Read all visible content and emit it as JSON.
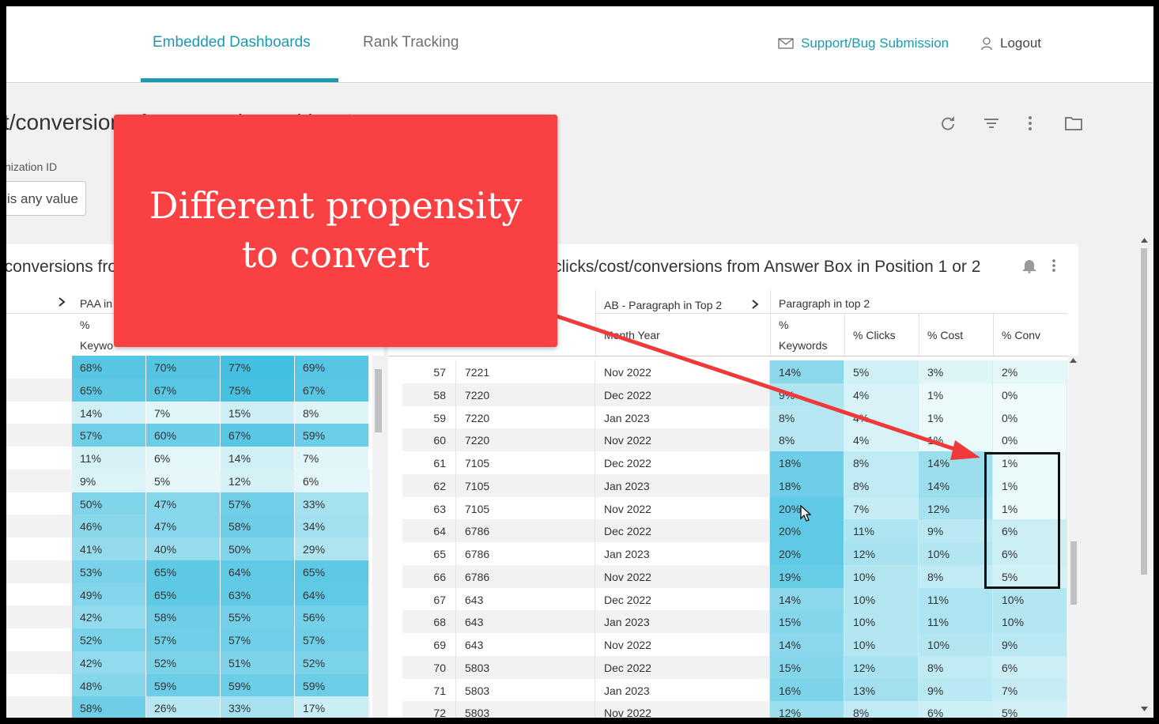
{
  "nav": {
    "tabs": [
      {
        "label": "Embedded Dashboards",
        "active": true
      },
      {
        "label": "Rank Tracking",
        "active": false
      }
    ],
    "support_label": "Support/Bug Submission",
    "logout_label": "Logout",
    "accent_color": "#1c9ab0"
  },
  "dashboard": {
    "title": "t/conversions from PAA in position 2",
    "filter_label": "nization ID",
    "filter_value": "is any value",
    "icons": [
      "refresh-icon",
      "filter-icon",
      "more-vert-icon",
      "folder-icon"
    ]
  },
  "left_tile": {
    "title": "t/conversions from PAA in Position 1 or 2",
    "group_header": "PAA in",
    "col_headers": [
      "%",
      "Keywo"
    ],
    "rows": [
      [
        "68%",
        "70%",
        "77%",
        "69%"
      ],
      [
        "65%",
        "67%",
        "75%",
        "67%"
      ],
      [
        "14%",
        "7%",
        "15%",
        "8%"
      ],
      [
        "57%",
        "60%",
        "67%",
        "59%"
      ],
      [
        "11%",
        "6%",
        "14%",
        "7%"
      ],
      [
        "9%",
        "5%",
        "12%",
        "6%"
      ],
      [
        "50%",
        "47%",
        "57%",
        "33%"
      ],
      [
        "46%",
        "47%",
        "58%",
        "34%"
      ],
      [
        "41%",
        "40%",
        "50%",
        "29%"
      ],
      [
        "53%",
        "65%",
        "64%",
        "65%"
      ],
      [
        "49%",
        "65%",
        "63%",
        "64%"
      ],
      [
        "42%",
        "58%",
        "55%",
        "56%"
      ],
      [
        "52%",
        "57%",
        "57%",
        "57%"
      ],
      [
        "42%",
        "52%",
        "51%",
        "52%"
      ],
      [
        "48%",
        "59%",
        "59%",
        "59%"
      ],
      [
        "58%",
        "26%",
        "33%",
        "17%"
      ]
    ]
  },
  "right_tile": {
    "title": "clicks/cost/conversions from Answer Box in Position 1 or 2",
    "group_header_1": "AB - Paragraph in Top 2",
    "group_header_2": "Paragraph in top 2",
    "col_month": "Month Year",
    "col_pct": "%",
    "col_keywords": "Keywords",
    "col_clicks": "% Clicks",
    "col_cost": "% Cost",
    "col_conv": "% Conv",
    "rows": [
      [
        "57",
        "7221",
        "Nov 2022",
        "14%",
        "5%",
        "3%",
        "2%"
      ],
      [
        "58",
        "7220",
        "Dec 2022",
        "9%",
        "4%",
        "1%",
        "0%"
      ],
      [
        "59",
        "7220",
        "Jan 2023",
        "8%",
        "4%",
        "1%",
        "0%"
      ],
      [
        "60",
        "7220",
        "Nov 2022",
        "8%",
        "4%",
        "1%",
        "0%"
      ],
      [
        "61",
        "7105",
        "Dec 2022",
        "18%",
        "8%",
        "14%",
        "1%"
      ],
      [
        "62",
        "7105",
        "Jan 2023",
        "18%",
        "8%",
        "14%",
        "1%"
      ],
      [
        "63",
        "7105",
        "Nov 2022",
        "20%",
        "7%",
        "12%",
        "1%"
      ],
      [
        "64",
        "6786",
        "Dec 2022",
        "20%",
        "11%",
        "9%",
        "6%"
      ],
      [
        "65",
        "6786",
        "Jan 2023",
        "20%",
        "12%",
        "10%",
        "6%"
      ],
      [
        "66",
        "6786",
        "Nov 2022",
        "19%",
        "10%",
        "8%",
        "5%"
      ],
      [
        "67",
        "643",
        "Dec 2022",
        "14%",
        "10%",
        "11%",
        "10%"
      ],
      [
        "68",
        "643",
        "Jan 2023",
        "15%",
        "10%",
        "11%",
        "10%"
      ],
      [
        "69",
        "643",
        "Nov 2022",
        "14%",
        "10%",
        "10%",
        "9%"
      ],
      [
        "70",
        "5803",
        "Dec 2022",
        "15%",
        "12%",
        "8%",
        "6%"
      ],
      [
        "71",
        "5803",
        "Jan 2023",
        "16%",
        "13%",
        "9%",
        "7%"
      ],
      [
        "72",
        "5803",
        "Nov 2022",
        "12%",
        "8%",
        "6%",
        "5%"
      ]
    ]
  },
  "annotation": {
    "callout_text_line1": "Different propensity",
    "callout_text_line2": "to convert",
    "callout_color": "#f94144",
    "arrow_color": "#f0393b"
  }
}
